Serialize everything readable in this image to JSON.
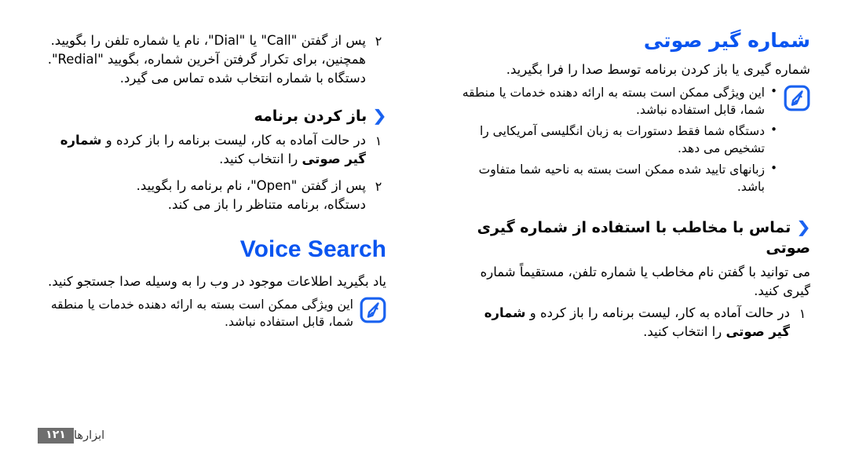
{
  "document": {
    "language": "fa",
    "direction": "rtl",
    "accent_color": "#0a55f0",
    "text_color": "#000000",
    "page_badge_color": "#6e6e6e"
  },
  "left_column": {
    "step_continued": {
      "number": "۲",
      "main_text": "پس از گفتن \"Call\" یا \"Dial\"، نام یا شماره تلفن را بگویید. همچنین، برای تکرار گرفتن آخرین شماره، بگویید \"Redial\".",
      "sub_text": "دستگاه با شماره انتخاب شده تماس می گیرد."
    },
    "heading_open_app": {
      "chevron": "❮",
      "text": "باز کردن برنامه"
    },
    "open_app_steps": [
      {
        "number": "۱",
        "main_text_prefix": "در حالت آماده به کار، لیست برنامه را باز کرده و ",
        "bold_part": "شماره گیر صوتی",
        "main_text_suffix": " را انتخاب کنید."
      },
      {
        "number": "۲",
        "main_text": "پس از گفتن \"Open\"، نام برنامه را بگویید.",
        "sub_text": "دستگاه، برنامه متناظر را باز می کند."
      }
    ],
    "voice_search": {
      "title": "Voice Search",
      "intro": "یاد بگیرید اطلاعات موجود در وب را به وسیله صدا جستجو کنید.",
      "note_icon": "note-pen-icon",
      "note_text": "این ویژگی ممکن است بسته به ارائه دهنده خدمات یا منطقه شما، قابل استفاده نباشد."
    }
  },
  "right_column": {
    "heading_voice_dialer": {
      "text": "شماره گیر صوتی"
    },
    "intro": "شماره گیری یا باز کردن برنامه توسط صدا را فرا بگیرید.",
    "note": {
      "icon": "note-pen-icon",
      "bullets": [
        "این ویژگی ممکن است بسته به ارائه دهنده خدمات یا منطقه شما، قابل استفاده نباشد.",
        "دستگاه شما فقط دستورات به زبان انگلیسی آمریکایی را تشخیص می دهد.",
        "زبانهای تایید شده ممکن است بسته به ناحیه شما متفاوت باشد."
      ]
    },
    "heading_call_contact": {
      "chevron": "❮",
      "text": "تماس با مخاطب با استفاده از شماره گیری صوتی"
    },
    "call_intro": "می توانید با گفتن نام مخاطب یا شماره تلفن، مستقیماً شماره گیری کنید.",
    "call_steps": [
      {
        "number": "۱",
        "main_text_prefix": "در حالت آماده به کار، لیست برنامه را باز کرده و ",
        "bold_part": "شماره گیر صوتی",
        "main_text_suffix": " را انتخاب کنید."
      }
    ]
  },
  "footer": {
    "page_number": "۱۲۱",
    "section_label": "ابزارها"
  }
}
